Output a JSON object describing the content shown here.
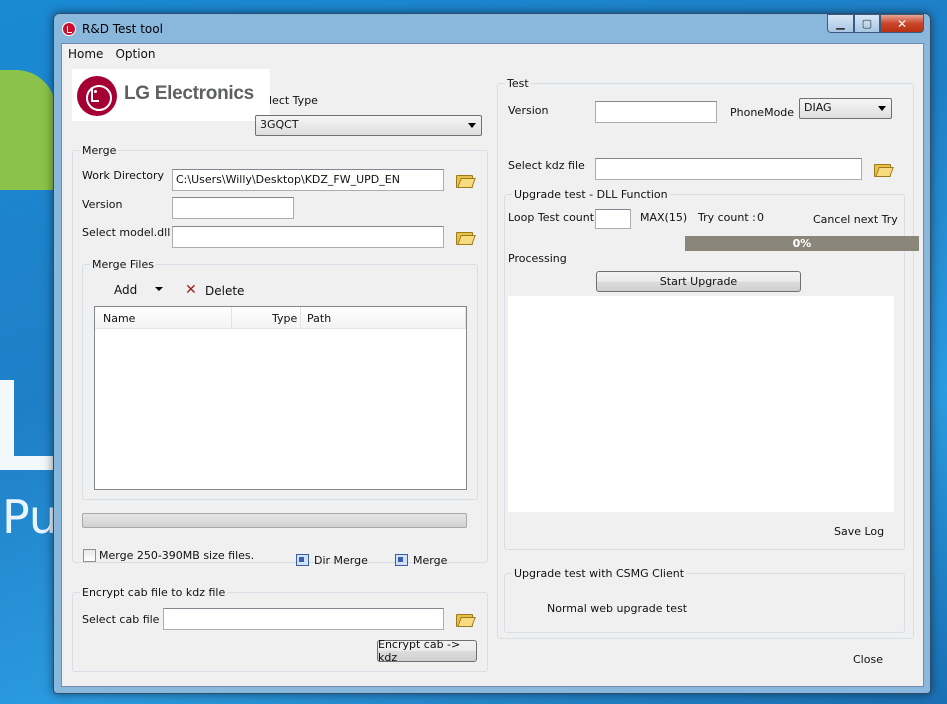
{
  "window": {
    "title": "R&D Test tool"
  },
  "menu": {
    "items": [
      "Home",
      "Option"
    ]
  },
  "logo": {
    "text": "LG Electronics"
  },
  "select_type": {
    "label": "lect Type",
    "value": "3GQCT"
  },
  "merge": {
    "title": "Merge",
    "work_dir_label": "Work Directory",
    "work_dir_value": "C:\\Users\\Willy\\Desktop\\KDZ_FW_UPD_EN",
    "version_label": "Version",
    "version_value": "",
    "model_label": "Select model.dll",
    "model_value": "",
    "files": {
      "title": "Merge Files",
      "add_label": "Add",
      "delete_label": "Delete",
      "columns": [
        "Name",
        "Type",
        "Path"
      ]
    },
    "checkbox_label": "Merge 250-390MB size files.",
    "checkbox_checked": false,
    "dir_merge_label": "Dir Merge",
    "merge_label": "Merge"
  },
  "encrypt": {
    "title": "Encrypt cab file to kdz file",
    "cab_label": "Select cab file",
    "cab_value": "",
    "button_label": "Encrypt cab -> kdz"
  },
  "test": {
    "title": "Test",
    "version_label": "Version",
    "version_value": "",
    "phone_mode_label": "PhoneMode",
    "phone_mode_value": "DIAG",
    "kdz_label": "Select kdz file",
    "kdz_value": "",
    "upgrade": {
      "title": "Upgrade test - DLL Function",
      "loop_label": "Loop Test count",
      "loop_value": "",
      "max_label": "MAX(15)",
      "try_label": "Try count :",
      "try_value": "0",
      "cancel_label": "Cancel next Try",
      "progress_text": "0%",
      "progress_value": 0,
      "processing_label": "Processing",
      "start_label": "Start Upgrade",
      "save_log_label": "Save Log"
    },
    "csmg": {
      "title": "Upgrade test with CSMG Client",
      "web_label": "Normal web upgrade test"
    }
  },
  "close_label": "Close"
}
